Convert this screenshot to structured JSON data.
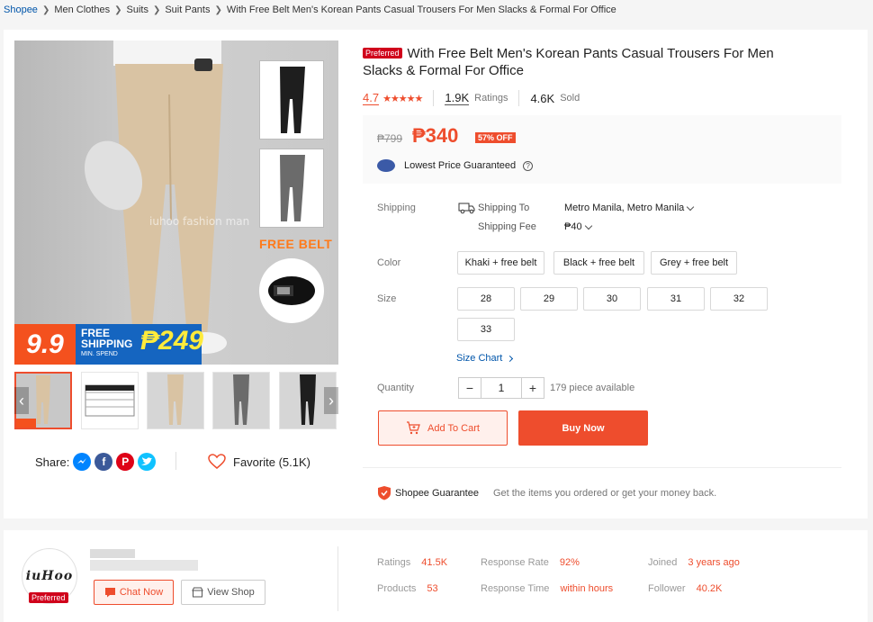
{
  "breadcrumb": [
    "Shopee",
    "Men Clothes",
    "Suits",
    "Suit Pants",
    "With Free Belt Men's Korean Pants Casual Trousers For Men Slacks & Formal For Office"
  ],
  "gallery": {
    "watermark": "iuhoo fashion man",
    "free_belt": "FREE BELT",
    "promo_99": "9.9",
    "promo_free": "FREE",
    "promo_shipping": "SHIPPING",
    "promo_min": "MIN. SPEND",
    "promo_amount": "₱249",
    "thumbnail_count": 5,
    "active_thumbnail": 1
  },
  "share": {
    "label": "Share:",
    "networks": [
      "messenger-icon",
      "facebook-icon",
      "pinterest-icon",
      "twitter-icon"
    ]
  },
  "favorite": {
    "label": "Favorite (5.1K)"
  },
  "product": {
    "preferred_tag": "Preferred",
    "title": "With Free Belt Men's Korean Pants Casual Trousers For Men Slacks & Formal For Office",
    "rating": "4.7",
    "stars": 5,
    "ratings_count": "1.9K",
    "ratings_label": "Ratings",
    "sold_count": "4.6K",
    "sold_label": "Sold"
  },
  "price": {
    "original": "₱799",
    "current": "₱340",
    "discount": "57% OFF",
    "lowest_label": "Lowest Price Guaranteed",
    "help_icon": "?"
  },
  "shipping": {
    "label": "Shipping",
    "to_label": "Shipping To",
    "destination": "Metro Manila, Metro Manila",
    "fee_label": "Shipping Fee",
    "fee": "₱40"
  },
  "color": {
    "label": "Color",
    "options": [
      "Khaki + free belt",
      "Black + free belt",
      "Grey + free belt"
    ]
  },
  "size": {
    "label": "Size",
    "options": [
      "28",
      "29",
      "30",
      "31",
      "32",
      "33"
    ],
    "chart_link": "Size Chart"
  },
  "quantity": {
    "label": "Quantity",
    "minus": "−",
    "value": "1",
    "plus": "+",
    "available": "179 piece available"
  },
  "actions": {
    "add_to_cart": "Add To Cart",
    "buy_now": "Buy Now"
  },
  "guarantee": {
    "title": "Shopee Guarantee",
    "desc": "Get the items you ordered or get your money back."
  },
  "shop": {
    "logo_text": "iuHoo",
    "preferred": "Preferred",
    "chat_now": "Chat Now",
    "view_shop": "View Shop",
    "stats": [
      {
        "label": "Ratings",
        "value": "41.5K"
      },
      {
        "label": "Response Rate",
        "value": "92%"
      },
      {
        "label": "Joined",
        "value": "3 years ago"
      },
      {
        "label": "Products",
        "value": "53"
      },
      {
        "label": "Response Time",
        "value": "within hours"
      },
      {
        "label": "Follower",
        "value": "40.2K"
      }
    ]
  },
  "colors": {
    "accent": "#ee4d2d",
    "link": "#0055aa",
    "preferred": "#d0011b"
  }
}
